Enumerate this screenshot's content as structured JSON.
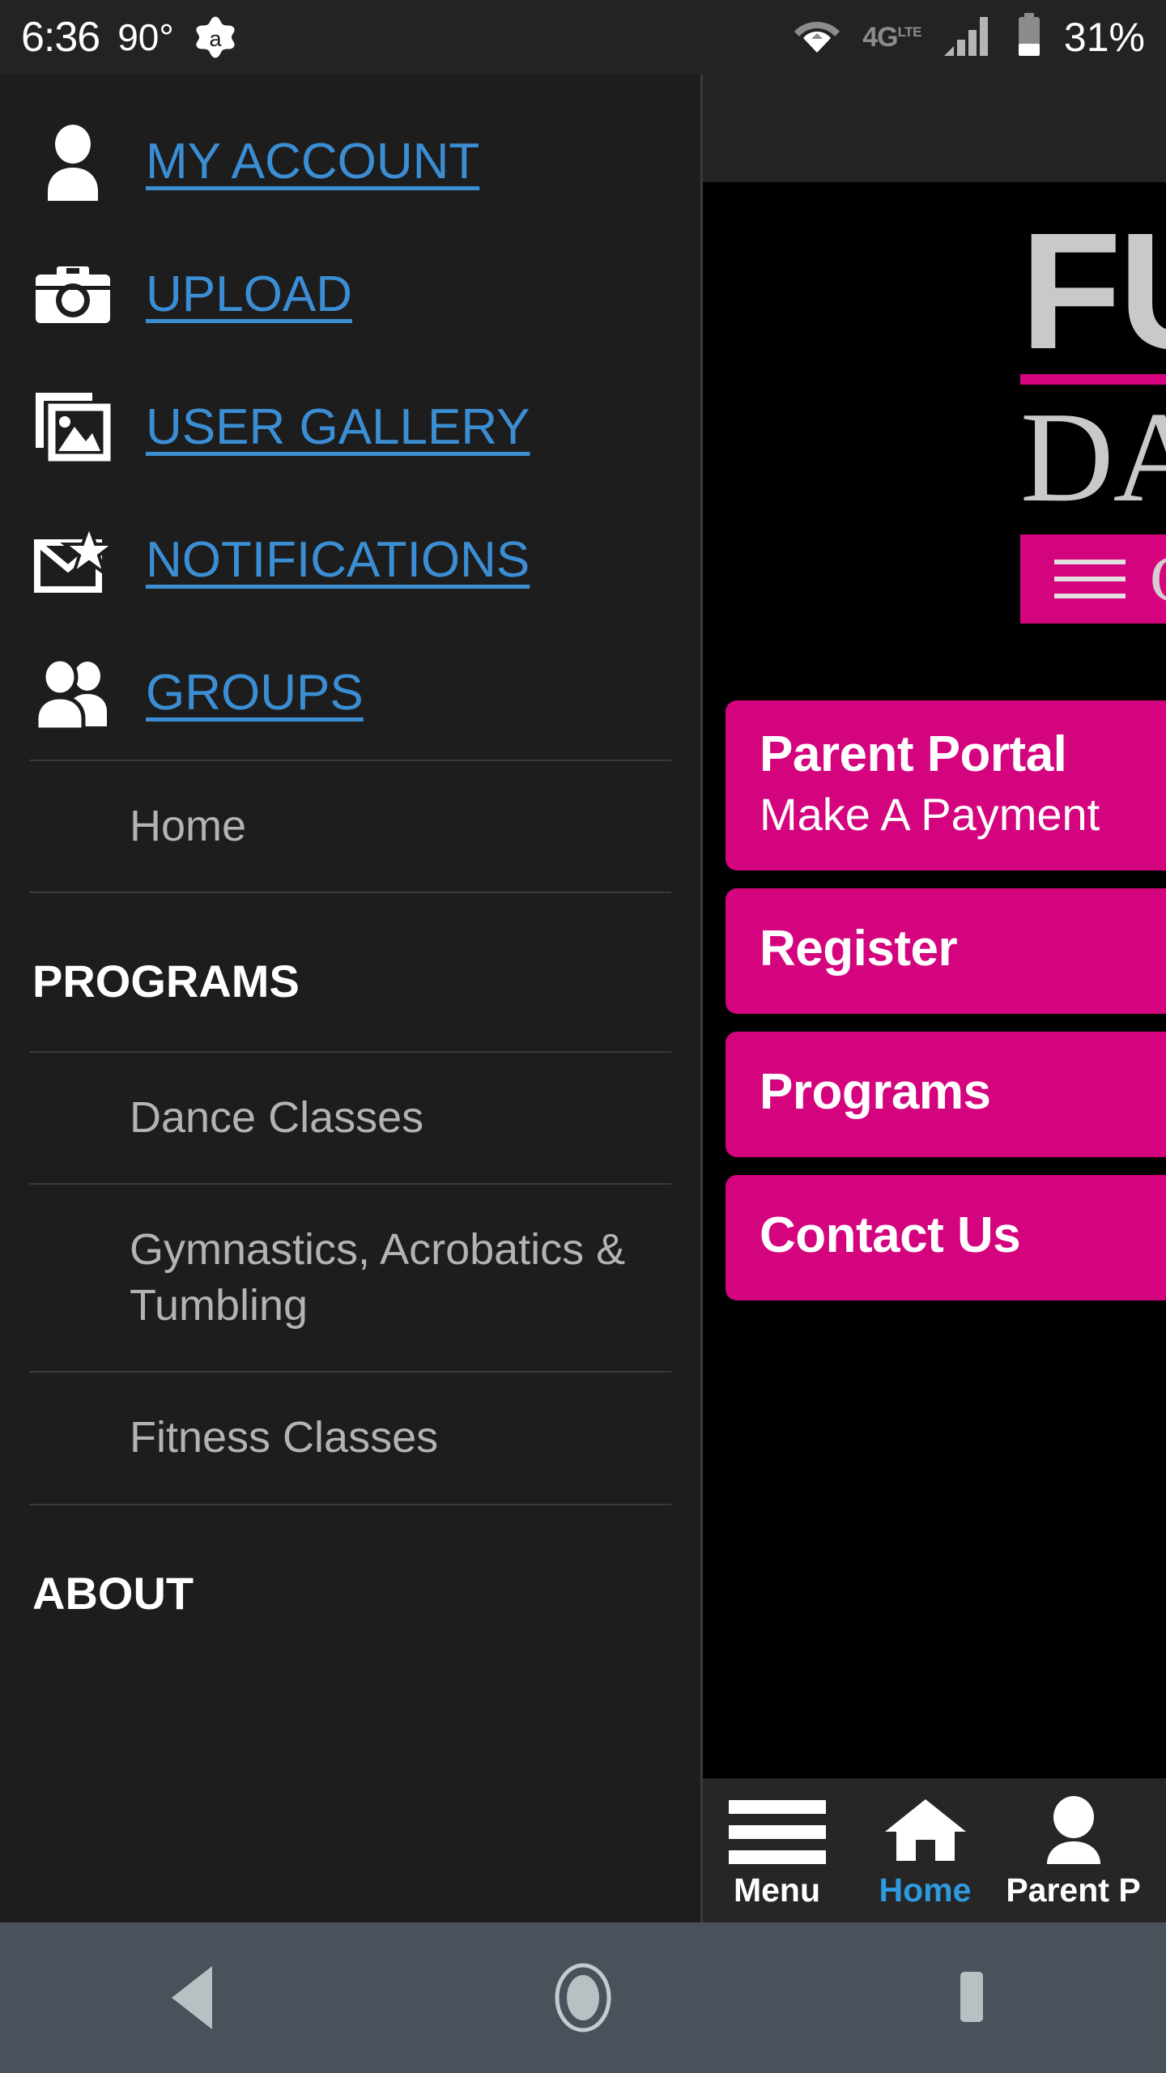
{
  "status_bar": {
    "clock": "6:36",
    "temperature": "90°",
    "app_icon": "avast-icon",
    "wifi_icon": "wifi-icon",
    "network_label": "4G",
    "network_suffix": "LTE",
    "signal_icon": "signal-bars-icon",
    "battery_icon": "battery-icon",
    "battery_percent": "31%"
  },
  "drawer": {
    "main_links": [
      {
        "label": "MY ACCOUNT",
        "icon": "person-icon"
      },
      {
        "label": "UPLOAD",
        "icon": "camera-icon"
      },
      {
        "label": "USER GALLERY",
        "icon": "photo-gallery-icon"
      },
      {
        "label": "NOTIFICATIONS",
        "icon": "envelope-star-icon"
      },
      {
        "label": "GROUPS",
        "icon": "people-group-icon"
      }
    ],
    "home_item": "Home",
    "programs_heading": "PROGRAMS",
    "programs_items": [
      "Dance Classes",
      "Gymnastics, Acrobatics & Tumbling",
      "Fitness Classes"
    ],
    "about_heading": "ABOUT"
  },
  "page": {
    "logo": {
      "line1": "FU",
      "line2": "DA",
      "bar_menu_icon": "hamburger-icon",
      "bar_text": "C"
    },
    "cta_buttons": [
      {
        "title": "Parent Portal",
        "subtitle": "Make A Payment"
      },
      {
        "title": "Register",
        "subtitle": ""
      },
      {
        "title": "Programs",
        "subtitle": ""
      },
      {
        "title": "Contact Us",
        "subtitle": ""
      }
    ]
  },
  "tabbar": {
    "items": [
      {
        "label": "Menu",
        "icon": "hamburger-icon",
        "active": false
      },
      {
        "label": "Home",
        "icon": "house-icon",
        "active": true
      },
      {
        "label": "Parent P",
        "icon": "person-icon",
        "active": false
      }
    ]
  },
  "android_nav": {
    "back": "back-triangle-icon",
    "home": "home-circle-icon",
    "recents": "recents-square-icon"
  },
  "colors": {
    "accent_pink": "#d4047f",
    "link_blue": "#3b8ed4",
    "tab_active_blue": "#2e9bdf",
    "drawer_bg": "#1d1d1d",
    "page_bg": "#000000",
    "statusbar_bg": "#232323",
    "android_nav_bg": "#49515a"
  }
}
